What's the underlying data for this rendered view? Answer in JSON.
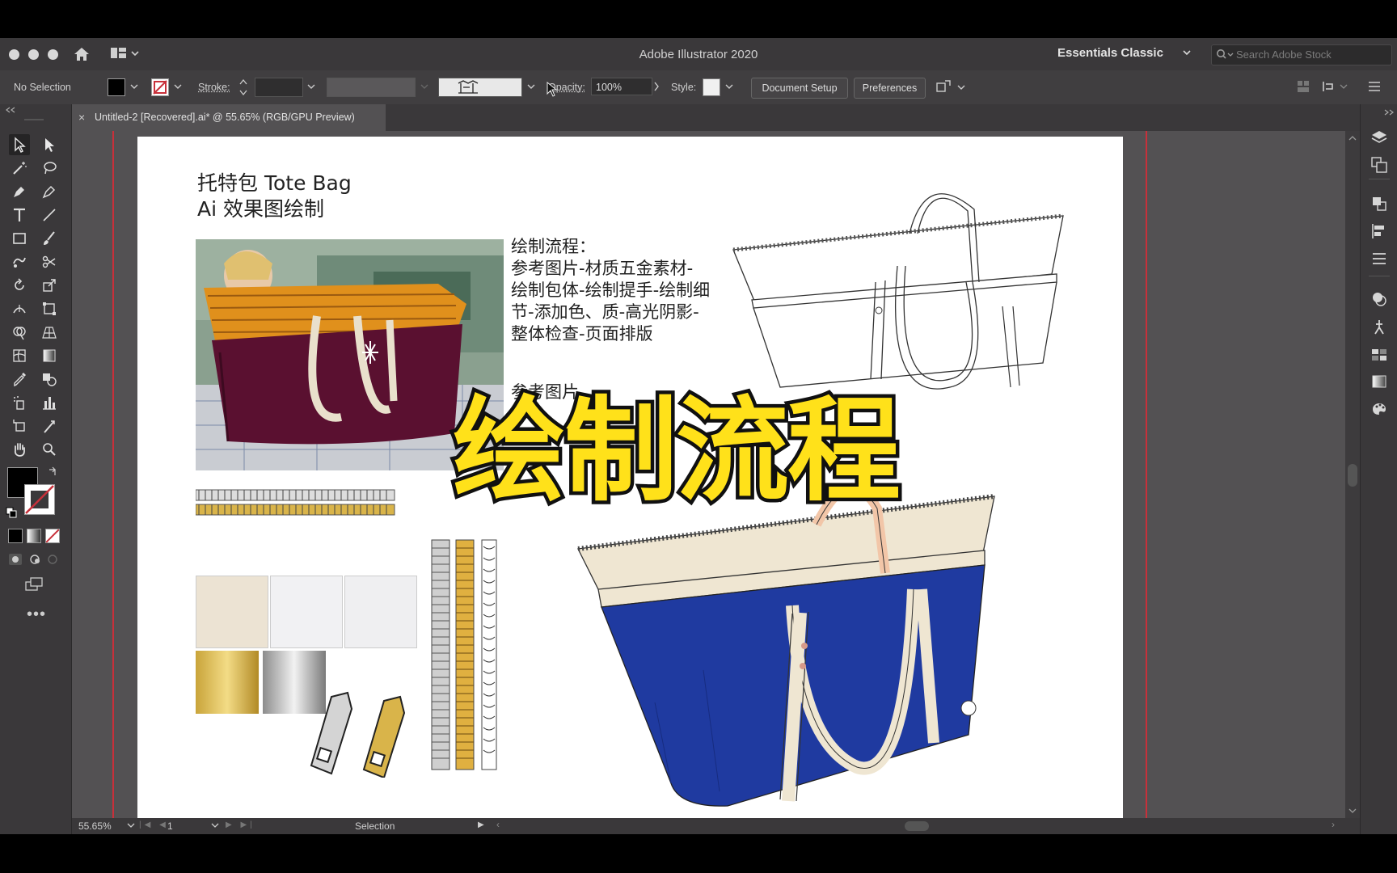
{
  "app": {
    "title": "Adobe Illustrator 2020",
    "workspace": "Essentials Classic",
    "search_placeholder": "Search Adobe Stock"
  },
  "control_bar": {
    "selection_status": "No Selection",
    "stroke_label": "Stroke:",
    "opacity_label": "Opacity:",
    "opacity_value": "100%",
    "style_label": "Style:",
    "document_setup_label": "Document Setup",
    "preferences_label": "Preferences"
  },
  "document": {
    "tab_label": "Untitled-2 [Recovered].ai* @ 55.65% (RGB/GPU Preview)",
    "close_glyph": "×"
  },
  "status_bar": {
    "zoom": "55.65%",
    "artboard_number": "1",
    "tool_name": "Selection"
  },
  "artboard": {
    "heading_line1": "托特包 Tote Bag",
    "heading_line2": "Ai 效果图绘制",
    "process_lines": [
      "绘制流程：",
      "参考图片-材质五金素材-",
      "绘制包体-绘制提手-绘制细",
      "节-添加色、质-高光阴影-",
      "整体检查-页面排版"
    ],
    "hidden_partial_text": "参考图片"
  },
  "overlay": {
    "title": "绘制流程"
  },
  "colors": {
    "ui_dark": "#3a383a",
    "ui_control": "#403e40",
    "canvas": "#535153",
    "artboard_guide": "#c8303a",
    "overlay_yellow": "#ffe11a",
    "bag_blue": "#1f3aa0",
    "bag_cream": "#efe6d2",
    "handle_peach": "#f2c6a8",
    "photo_bag_purple": "#5a1030",
    "photo_bag_orange": "#e0901c",
    "gold": "#d9b44a",
    "silver": "#b4b4b4"
  }
}
